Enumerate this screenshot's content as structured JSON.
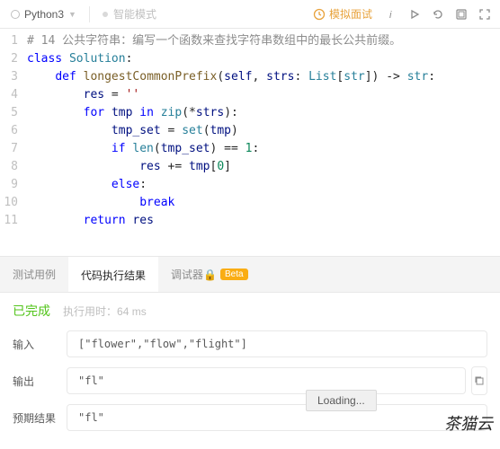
{
  "toolbar": {
    "language": "Python3",
    "smart_mode": "智能模式",
    "mock_interview": "模拟面试"
  },
  "code": {
    "lines": [
      {
        "n": 1,
        "indent": 0,
        "type": "comment",
        "text": "# 14 公共字符串：编写一个函数来查找字符串数组中的最长公共前缀。"
      },
      {
        "n": 2,
        "indent": 0,
        "type": "class"
      },
      {
        "n": 3,
        "indent": 1,
        "type": "def"
      },
      {
        "n": 4,
        "indent": 2,
        "type": "assign_res"
      },
      {
        "n": 5,
        "indent": 2,
        "type": "for"
      },
      {
        "n": 6,
        "indent": 3,
        "type": "assign_set"
      },
      {
        "n": 7,
        "indent": 3,
        "type": "if"
      },
      {
        "n": 8,
        "indent": 4,
        "type": "augassign"
      },
      {
        "n": 9,
        "indent": 3,
        "type": "else"
      },
      {
        "n": 10,
        "indent": 4,
        "type": "break"
      },
      {
        "n": 11,
        "indent": 2,
        "type": "return"
      }
    ],
    "tokens": {
      "cls_kw": "class",
      "cls_name": "Solution",
      "def_kw": "def",
      "fn_name": "longestCommonPrefix",
      "self": "self",
      "param": "strs",
      "list_t": "List",
      "str_t": "str",
      "arrow": "str",
      "res": "res",
      "empty": "''",
      "for_kw": "for",
      "tmp": "tmp",
      "in_kw": "in",
      "zip": "zip",
      "star_strs": "strs",
      "tmp_set": "tmp_set",
      "set": "set",
      "if_kw": "if",
      "len": "len",
      "eq": "==",
      "one": "1",
      "aug": "+=",
      "zero": "0",
      "else_kw": "else",
      "break_kw": "break",
      "return_kw": "return"
    }
  },
  "tabs": {
    "test_cases": "测试用例",
    "exec_result": "代码执行结果",
    "debugger": "调试器",
    "beta": "Beta"
  },
  "result": {
    "status": "已完成",
    "runtime_label": "执行用时：",
    "runtime_value": "64 ms",
    "input_label": "输入",
    "input_value": "[\"flower\",\"flow\",\"flight\"]",
    "output_label": "输出",
    "output_value": "\"fl\"",
    "expected_label": "预期结果",
    "expected_value": "\"fl\""
  },
  "loading": "Loading...",
  "watermark": "茶猫云"
}
